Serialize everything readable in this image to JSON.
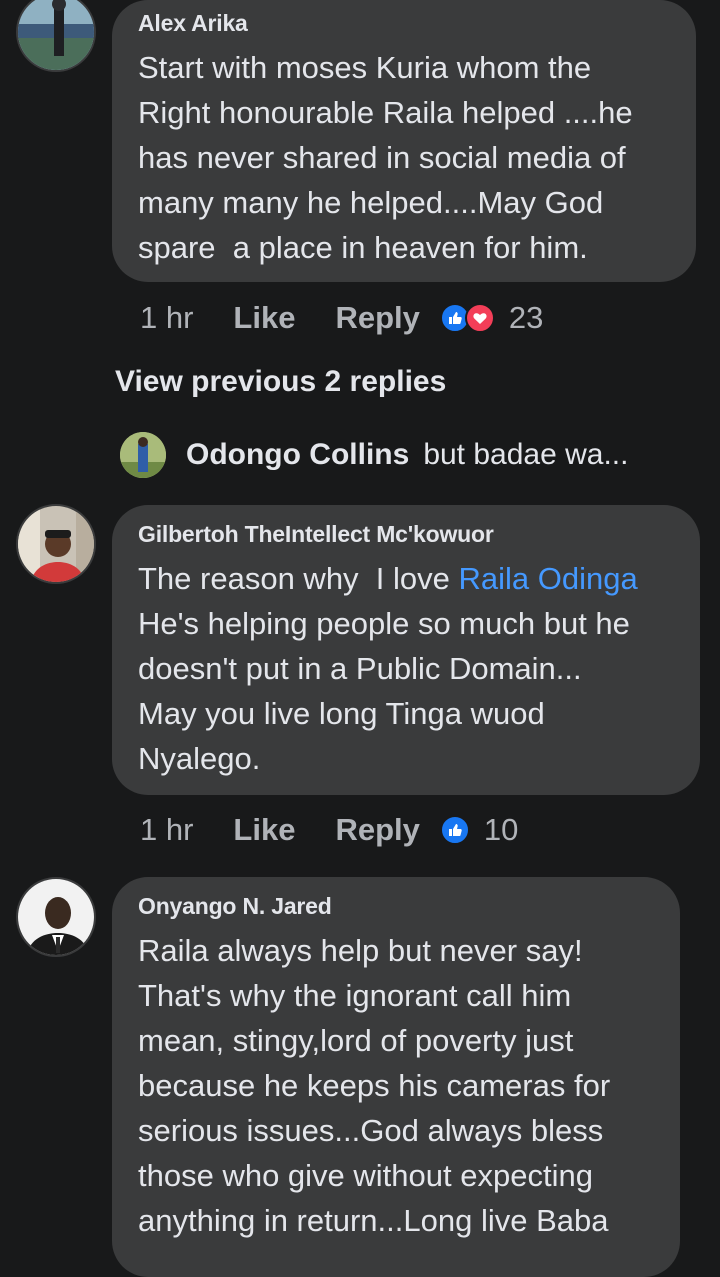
{
  "comments": [
    {
      "author": "Alex Arika",
      "lines": [
        "Start with moses Kuria whom the",
        "Right honourable Raila helped ....he",
        "has never shared in social media of",
        "many many he helped....May God",
        "spare  a place in heaven for him."
      ],
      "time": "1 hr",
      "like_label": "Like",
      "reply_label": "Reply",
      "reactions": [
        "like-icon",
        "love-icon"
      ],
      "reaction_count": "23"
    },
    {
      "author": "Gilbertoh TheIntellect Mc'kowuor",
      "line1_prefix": "The reason why  I love ",
      "mention": "Raila Odinga",
      "lines": [
        "He's helping people so much but he",
        "doesn't put in a Public Domain...",
        "May you live long Tinga wuod",
        "Nyalego."
      ],
      "time": "1 hr",
      "like_label": "Like",
      "reply_label": "Reply",
      "reactions": [
        "like-icon"
      ],
      "reaction_count": "10"
    },
    {
      "author": "Onyango N. Jared",
      "lines": [
        "Raila always help but never say!",
        "That's why the ignorant call him",
        "mean, stingy,lord of poverty just",
        "because he keeps his cameras for",
        "serious issues...God always bless",
        "those who give without expecting",
        "anything in return...Long live Baba"
      ]
    }
  ],
  "view_previous_label": "View previous 2 replies",
  "reply_preview": {
    "author": "Odongo Collins",
    "text": "but badae wa..."
  },
  "colors": {
    "background": "#18191a",
    "bubble": "#3a3b3c",
    "text": "#e4e6eb",
    "secondary_text": "#b0b3b8",
    "mention": "#4599ff",
    "like_reaction": "#1877f2",
    "love_reaction": "#f33e58"
  }
}
